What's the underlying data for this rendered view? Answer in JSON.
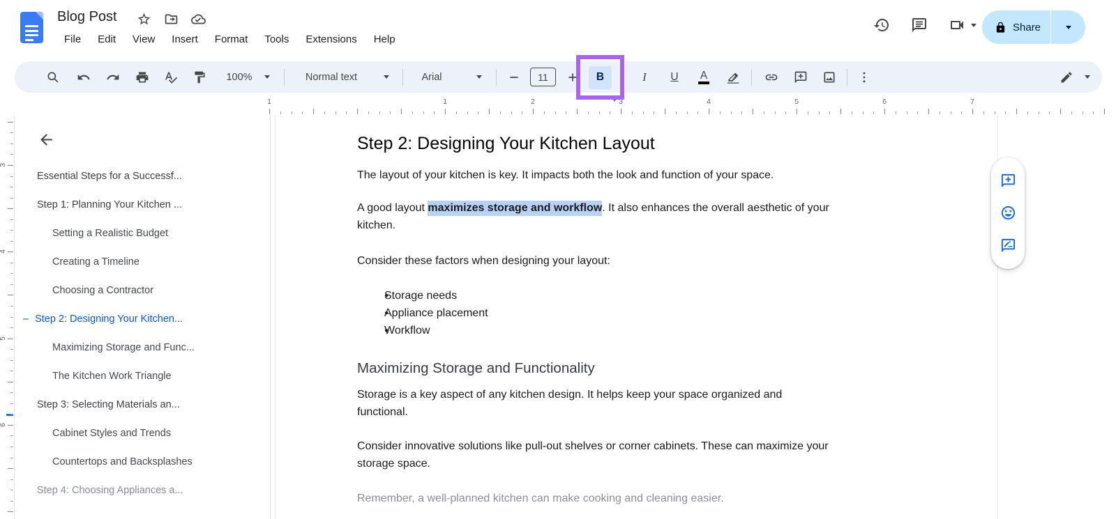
{
  "header": {
    "title": "Blog Post",
    "menus": [
      "File",
      "Edit",
      "View",
      "Insert",
      "Format",
      "Tools",
      "Extensions",
      "Help"
    ],
    "share_label": "Share"
  },
  "toolbar": {
    "zoom_value": "100%",
    "paragraph_style": "Normal text",
    "font_name": "Arial",
    "font_size": "11",
    "bold": "B",
    "italic": "I",
    "underline": "U",
    "text_color": "A"
  },
  "ruler": {
    "horizontal_numbers": [
      "1",
      "1",
      "2",
      "3",
      "4",
      "5",
      "6",
      "7"
    ],
    "vertical_numbers": [
      "3",
      "4",
      "5",
      "6"
    ]
  },
  "outline": {
    "active_marker": "–",
    "items": [
      {
        "label": "Essential Steps for a Successf...",
        "level": 1,
        "active": false,
        "muted": false
      },
      {
        "label": "Step 1: Planning Your Kitchen ...",
        "level": 1,
        "active": false,
        "muted": false
      },
      {
        "label": "Setting a Realistic Budget",
        "level": 2,
        "active": false,
        "muted": false
      },
      {
        "label": "Creating a Timeline",
        "level": 2,
        "active": false,
        "muted": false
      },
      {
        "label": "Choosing a Contractor",
        "level": 2,
        "active": false,
        "muted": false
      },
      {
        "label": "Step 2: Designing Your Kitchen...",
        "level": 1,
        "active": true,
        "muted": false
      },
      {
        "label": "Maximizing Storage and Func...",
        "level": 2,
        "active": false,
        "muted": false
      },
      {
        "label": "The Kitchen Work Triangle",
        "level": 2,
        "active": false,
        "muted": false
      },
      {
        "label": "Step 3: Selecting Materials an...",
        "level": 1,
        "active": false,
        "muted": false
      },
      {
        "label": "Cabinet Styles and Trends",
        "level": 2,
        "active": false,
        "muted": false
      },
      {
        "label": "Countertops and Backsplashes",
        "level": 2,
        "active": false,
        "muted": false
      },
      {
        "label": "Step 4: Choosing Appliances a...",
        "level": 1,
        "active": false,
        "muted": true
      }
    ]
  },
  "doc": {
    "heading": "Step 2: Designing Your Kitchen Layout",
    "para1": "The layout of your kitchen is key. It impacts both the look and function of your space.",
    "para2": {
      "before": "A good layout ",
      "bold": "maximizes storage and workflow",
      "after_line1": ". It also enhances the overall aesthetic of your",
      "line2": "kitchen."
    },
    "para3": "Consider these factors when designing your layout:",
    "bullets": [
      "Storage needs",
      "Appliance placement",
      "Workflow"
    ],
    "heading2": "Maximizing Storage and Functionality",
    "para4_line1": "Storage is a key aspect of any kitchen design. It helps keep your space organized and",
    "para4_line2": "functional.",
    "para5_line1": "Consider innovative solutions like pull-out shelves or corner cabinets. These can maximize your",
    "para5_line2": "storage space.",
    "para6": "Remember, a well-planned kitchen can make cooking and cleaning easier."
  },
  "colors": {
    "accent_blue": "#0b57d0",
    "share_pill": "#c2e7ff",
    "toolbar_bg": "#edf2fa",
    "selection_highlight": "#b8d2f5",
    "annotation_purple": "#a864ec",
    "active_button_bg": "#d3e3fd",
    "icon_gray": "#444746"
  }
}
